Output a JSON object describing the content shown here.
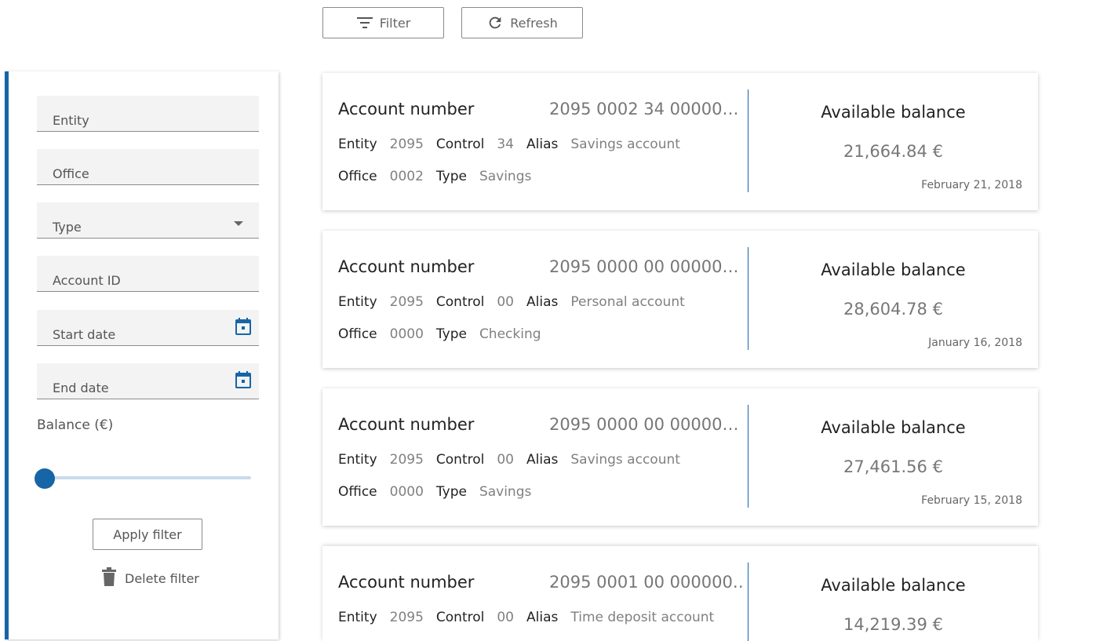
{
  "toolbar": {
    "filter_label": "Filter",
    "refresh_label": "Refresh"
  },
  "sidebar": {
    "fields": {
      "entity": "Entity",
      "office": "Office",
      "type": "Type",
      "account_id": "Account ID",
      "start_date": "Start date",
      "end_date": "End date"
    },
    "balance_label": "Balance (€)",
    "slider_value": 0,
    "apply_label": "Apply filter",
    "delete_label": "Delete filter"
  },
  "labels": {
    "account_number": "Account number",
    "entity": "Entity",
    "control": "Control",
    "alias": "Alias",
    "office": "Office",
    "type": "Type",
    "available_balance": "Available balance"
  },
  "accounts": [
    {
      "number": "2095 0002 34 00000…",
      "entity": "2095",
      "control": "34",
      "alias": "Savings account",
      "office": "0002",
      "type": "Savings",
      "balance": "21,664.84 €",
      "date": "February 21, 2018"
    },
    {
      "number": "2095 0000 00 00000…",
      "entity": "2095",
      "control": "00",
      "alias": "Personal account",
      "office": "0000",
      "type": "Checking",
      "balance": "28,604.78 €",
      "date": "January 16, 2018"
    },
    {
      "number": "2095 0000 00 00000…",
      "entity": "2095",
      "control": "00",
      "alias": "Savings account",
      "office": "0000",
      "type": "Savings",
      "balance": "27,461.56 €",
      "date": "February 15, 2018"
    },
    {
      "number": "2095 0001 00 000000…",
      "entity": "2095",
      "control": "00",
      "alias": "Time deposit account",
      "office": "",
      "type": "",
      "balance": "14,219.39 €",
      "date": ""
    }
  ],
  "colors": {
    "accent": "#1565a7",
    "slider_track": "#c9dbeb"
  }
}
